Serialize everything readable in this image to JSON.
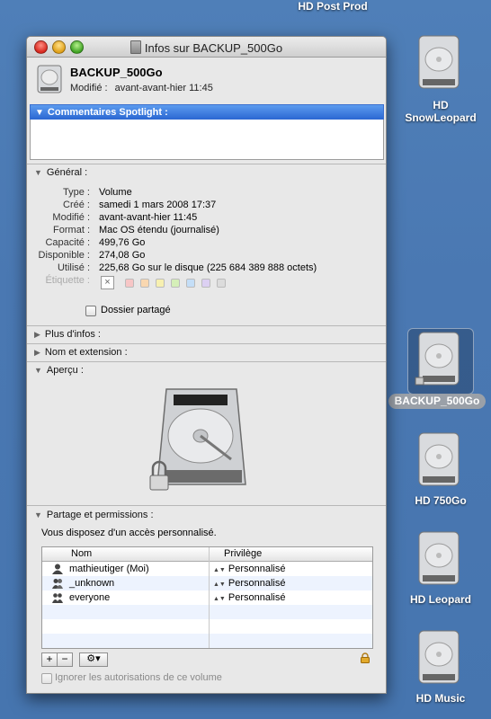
{
  "desktop": {
    "top_label": "HD Post Prod",
    "icons": [
      {
        "label": "HD\nSnowLeopard"
      },
      {
        "label": "BACKUP_500Go",
        "selected": true
      },
      {
        "label": "HD 750Go"
      },
      {
        "label": "HD Leopard"
      },
      {
        "label": "HD Music"
      }
    ]
  },
  "window": {
    "title": "Infos sur BACKUP_500Go",
    "header": {
      "name": "BACKUP_500Go",
      "modified_key": "Modifié :",
      "modified_value": "avant-avant-hier 11:45"
    },
    "spotlight": {
      "label": "Commentaires Spotlight :",
      "value": ""
    },
    "general": {
      "label": "Général :",
      "rows": [
        {
          "key": "Type :",
          "value": "Volume"
        },
        {
          "key": "Créé :",
          "value": "samedi 1 mars 2008 17:37"
        },
        {
          "key": "Modifié :",
          "value": "avant-avant-hier 11:45"
        },
        {
          "key": "Format :",
          "value": "Mac OS étendu (journalisé)"
        },
        {
          "key": "Capacité :",
          "value": "499,76 Go"
        },
        {
          "key": "Disponible :",
          "value": "274,08 Go"
        },
        {
          "key": "Utilisé :",
          "value": "225,68 Go sur le disque (225 684 389 888 octets)"
        }
      ],
      "label_key": "Étiquette :",
      "label_colors": [
        "#f7c6c6",
        "#f9d7b0",
        "#f7f0b0",
        "#d5efb8",
        "#c4def7",
        "#dcd0f2",
        "#dcdcdc"
      ],
      "shared_folder": "Dossier partagé"
    },
    "sections": {
      "more_info": "Plus d'infos :",
      "name_ext": "Nom et extension :",
      "preview": "Aperçu :",
      "sharing": "Partage et permissions :"
    },
    "permissions": {
      "access_text": "Vous disposez d'un accès personnalisé.",
      "col_name": "Nom",
      "col_priv": "Privilège",
      "rows": [
        {
          "name": "mathieutiger (Moi)",
          "privilege": "Personnalisé",
          "icon": "user-icon"
        },
        {
          "name": "_unknown",
          "privilege": "Personnalisé",
          "icon": "group-icon"
        },
        {
          "name": "everyone",
          "privilege": "Personnalisé",
          "icon": "everyone-icon"
        }
      ],
      "add_label": "+",
      "remove_label": "−",
      "action_label": "⚙▾",
      "ignore_label": "Ignorer les autorisations de ce volume"
    }
  }
}
